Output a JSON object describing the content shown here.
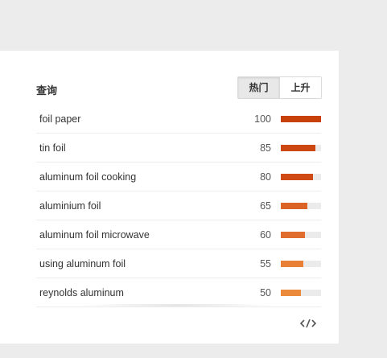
{
  "widget": {
    "title": "查询",
    "tabs": [
      {
        "label": "热门",
        "active": true
      },
      {
        "label": "上升",
        "active": false
      }
    ],
    "rows": [
      {
        "label": "foil paper",
        "value": "100",
        "level": 1.0,
        "color": "#c8400a"
      },
      {
        "label": "tin foil",
        "value": "85",
        "level": 0.85,
        "color": "#cc4712"
      },
      {
        "label": "aluminum foil cooking",
        "value": "80",
        "level": 0.8,
        "color": "#cf4a14"
      },
      {
        "label": "aluminium foil",
        "value": "65",
        "level": 0.65,
        "color": "#dc6326"
      },
      {
        "label": "aluminum foil microwave",
        "value": "60",
        "level": 0.6,
        "color": "#e06c2d"
      },
      {
        "label": "using aluminum foil",
        "value": "55",
        "level": 0.55,
        "color": "#e88136"
      },
      {
        "label": "reynolds aluminum",
        "value": "50",
        "level": 0.5,
        "color": "#ec8a3b"
      }
    ],
    "embed_icon": "code-embed-icon"
  }
}
